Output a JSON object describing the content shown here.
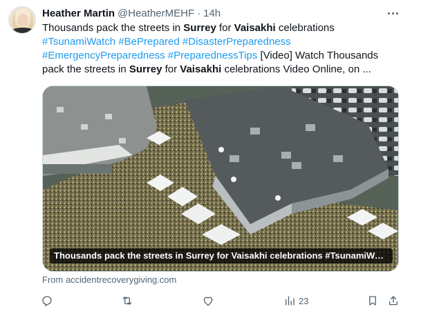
{
  "tweet": {
    "author_name": "Heather Martin",
    "author_handle": "@HeatherMEHF",
    "separator": "·",
    "time": "14h",
    "text": {
      "l1_a": "Thousands pack the streets in ",
      "l1_b": "Surrey",
      "l1_c": " for ",
      "l1_d": "Vaisakhi",
      "l1_e": " celebrations",
      "tag1": "#TsunamiWatch",
      "tag2": "#BePrepared",
      "tag3": "#DisasterPreparedness",
      "tag4": "#EmergencyPreparedness",
      "tag5": "#PreparednessTips",
      "l3_a": " [Video] Watch Thousands",
      "l4_a": "pack the streets in ",
      "l4_b": "Surrey",
      "l4_c": " for ",
      "l4_d": "Vaisakhi",
      "l4_e": " celebrations Video Online, on ..."
    },
    "media_caption": "Thousands pack the streets in Surrey for Vaisakhi celebrations #TsunamiWatch #BePrepared",
    "source": "From accidentrecoverygiving.com",
    "actions": {
      "reply_icon": "reply-icon",
      "retweet_icon": "retweet-icon",
      "like_icon": "like-icon",
      "views_icon": "views-icon",
      "views_count": "23",
      "bookmark_icon": "bookmark-icon",
      "share_icon": "share-icon"
    }
  },
  "colors": {
    "link": "#1d9bf0",
    "text": "#0f1419",
    "secondary": "#536471"
  }
}
